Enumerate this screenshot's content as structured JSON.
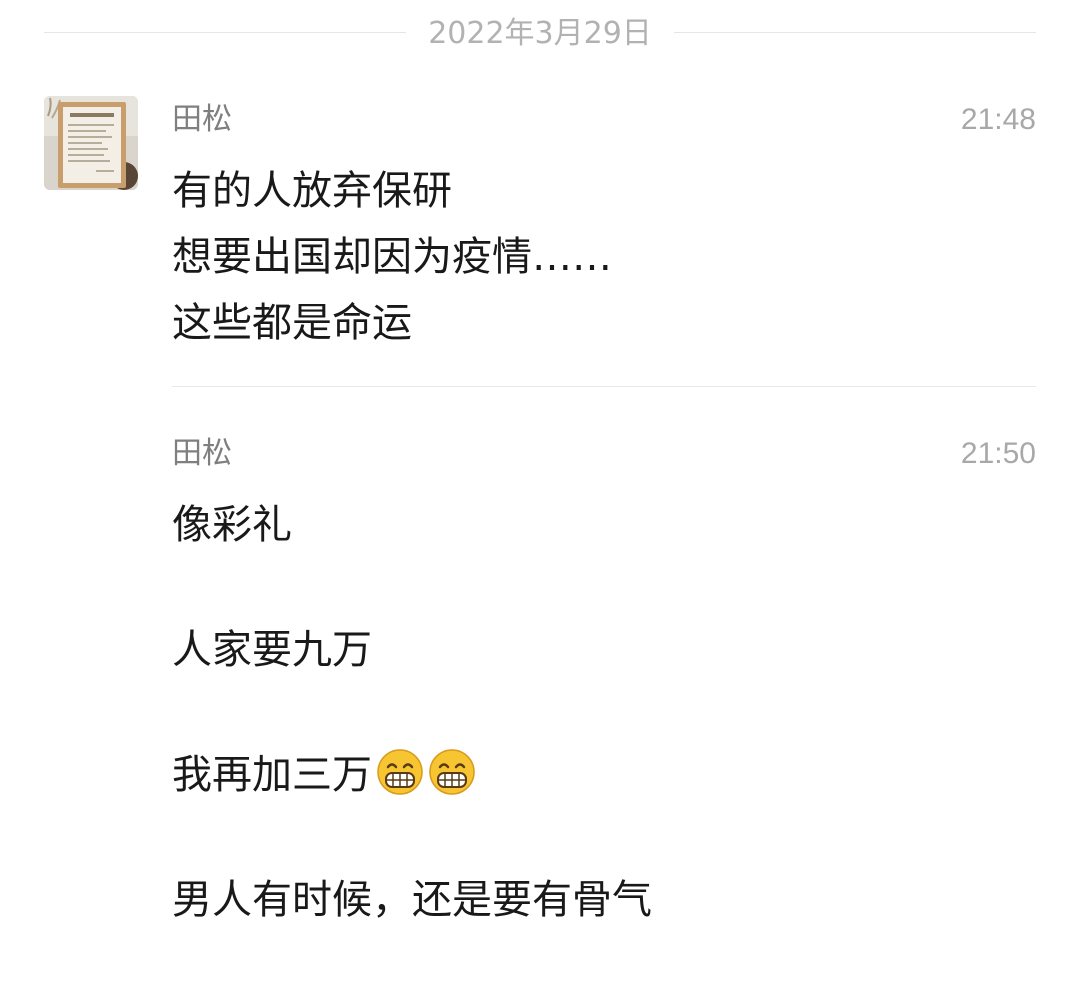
{
  "date_divider": "2022年3月29日",
  "messages": [
    {
      "sender": "田松",
      "time": "21:48",
      "lines": [
        "有的人放弃保研",
        "想要出国却因为疫情……",
        "这些都是命运"
      ]
    },
    {
      "sender": "田松",
      "time": "21:50",
      "lines": [
        "像彩礼",
        "人家要九万",
        "我再加三万",
        "男人有时候，还是要有骨气"
      ],
      "emojis": [
        "grinning-face-icon",
        "grinning-face-icon"
      ]
    }
  ],
  "avatar": {
    "icon": "framed-picture-avatar",
    "frame_title": "六项精进"
  },
  "colors": {
    "divider_text": "#b2b2b2",
    "sender": "#7f7f7f",
    "time": "#a8a8a8",
    "message_text": "#191919",
    "emoji": "#f7c531"
  }
}
